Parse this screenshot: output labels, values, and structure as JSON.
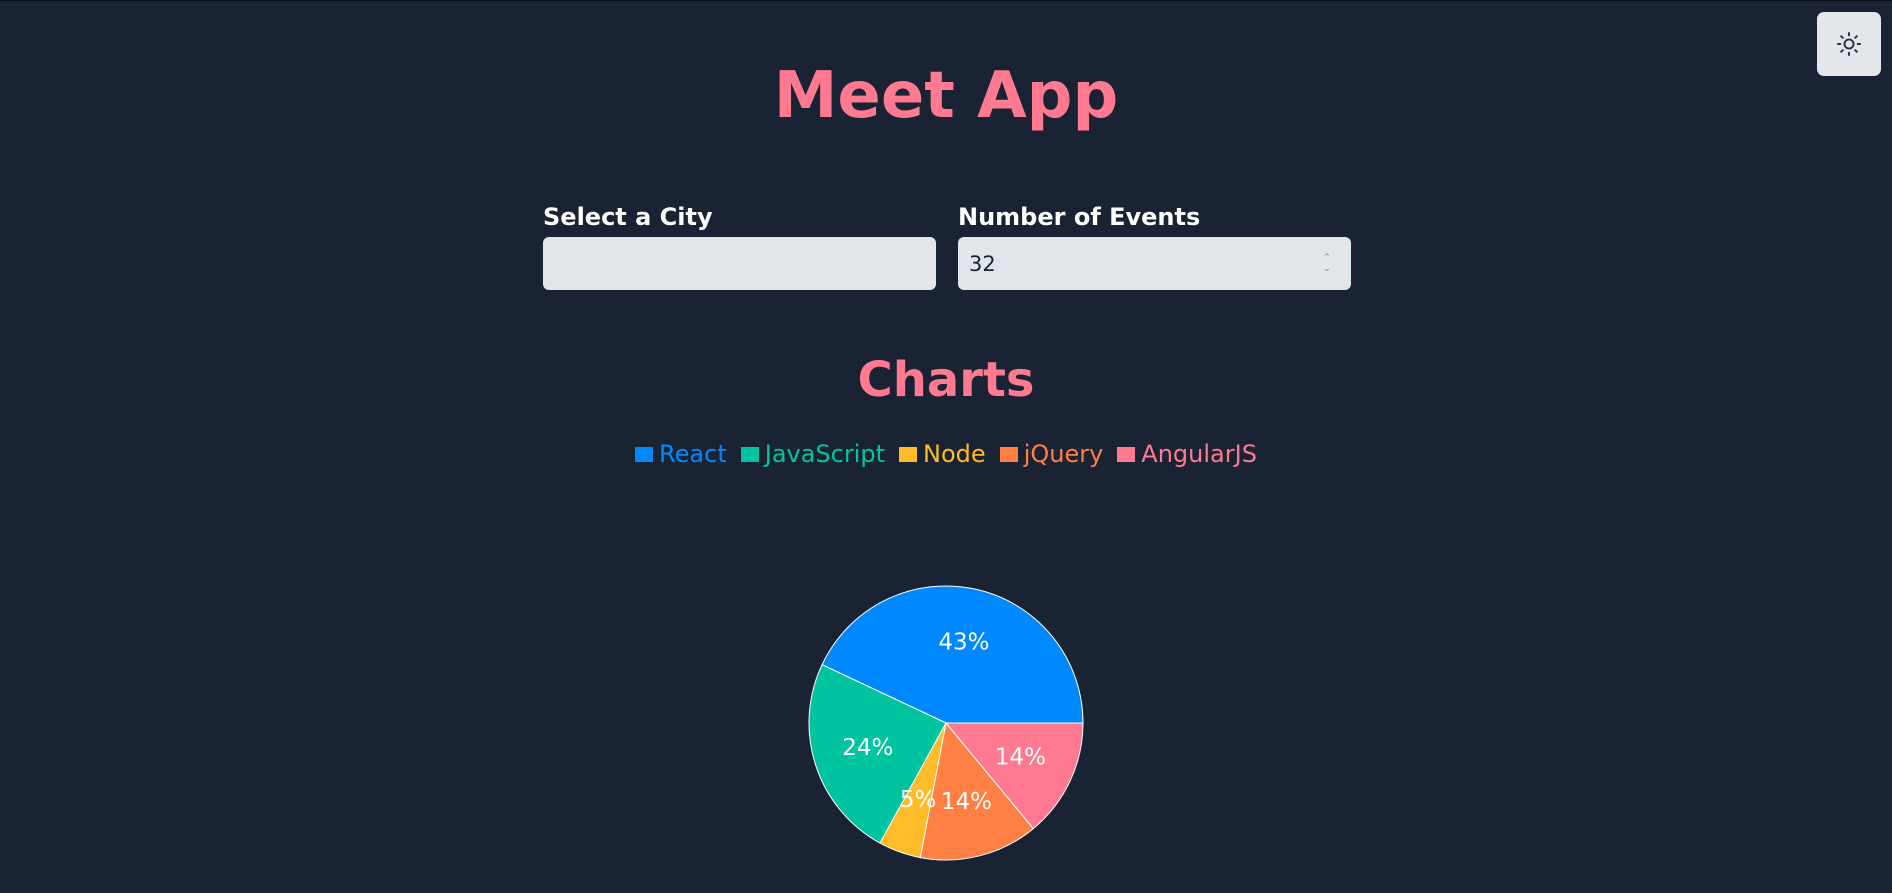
{
  "app": {
    "title": "Meet App"
  },
  "controls": {
    "city_label": "Select a City",
    "city_value": "",
    "events_label": "Number of Events",
    "events_value": "32"
  },
  "theme_toggle": {
    "icon": "sun-icon"
  },
  "charts_section": {
    "title": "Charts"
  },
  "chart_data": {
    "type": "pie",
    "title": "",
    "categories": [
      "React",
      "JavaScript",
      "Node",
      "jQuery",
      "AngularJS"
    ],
    "values": [
      43,
      24,
      5,
      14,
      14
    ],
    "labels": [
      "43%",
      "24%",
      "5%",
      "14%",
      "14%"
    ],
    "colors": [
      "#0088fe",
      "#00c49f",
      "#ffbb28",
      "#ff8042",
      "#ff7a90"
    ],
    "legend_position": "top"
  }
}
